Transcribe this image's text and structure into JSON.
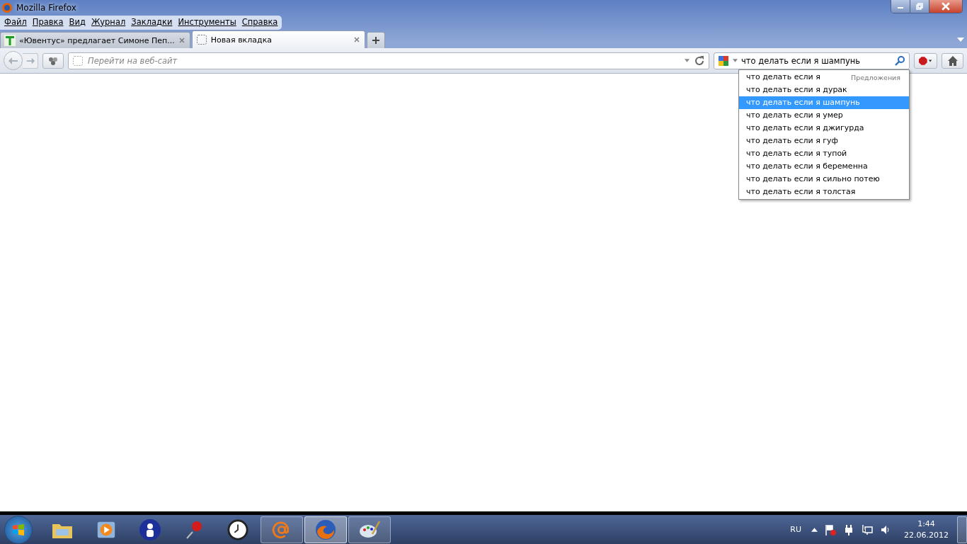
{
  "window": {
    "title": "Mozilla Firefox"
  },
  "menu": [
    "Файл",
    "Правка",
    "Вид",
    "Журнал",
    "Закладки",
    "Инструменты",
    "Справка"
  ],
  "tabs": [
    {
      "title": "«Ювентус» предлагает Симоне Пеп...",
      "selected": false,
      "kind": "site"
    },
    {
      "title": "Новая вкладка",
      "selected": true,
      "kind": "blank"
    }
  ],
  "address": {
    "placeholder": "Перейти на веб-сайт"
  },
  "search": {
    "value": "что делать если я шампунь"
  },
  "suggestions": {
    "header": "Предложения",
    "items": [
      {
        "text": "что делать если я",
        "selected": false
      },
      {
        "text": "что делать если я дурак",
        "selected": false
      },
      {
        "text": "что делать если я шампунь",
        "selected": true
      },
      {
        "text": "что делать если я умер",
        "selected": false
      },
      {
        "text": "что делать если я джигурда",
        "selected": false
      },
      {
        "text": "что делать если я гуф",
        "selected": false
      },
      {
        "text": "что делать если я тупой",
        "selected": false
      },
      {
        "text": "что делать если я беременна",
        "selected": false
      },
      {
        "text": "что делать если я сильно потею",
        "selected": false
      },
      {
        "text": "что делать если я толстая",
        "selected": false
      }
    ]
  },
  "taskbar": [
    {
      "kind": "folder",
      "running": false,
      "active": false
    },
    {
      "kind": "media",
      "running": false,
      "active": false
    },
    {
      "kind": "person",
      "running": false,
      "active": false
    },
    {
      "kind": "pin",
      "running": false,
      "active": false
    },
    {
      "kind": "clock",
      "running": false,
      "active": false
    },
    {
      "kind": "mail",
      "running": true,
      "active": false
    },
    {
      "kind": "firefox",
      "running": true,
      "active": true
    },
    {
      "kind": "paint",
      "running": true,
      "active": false
    }
  ],
  "tray": {
    "language": "RU",
    "time": "1:44",
    "date": "22.06.2012"
  }
}
